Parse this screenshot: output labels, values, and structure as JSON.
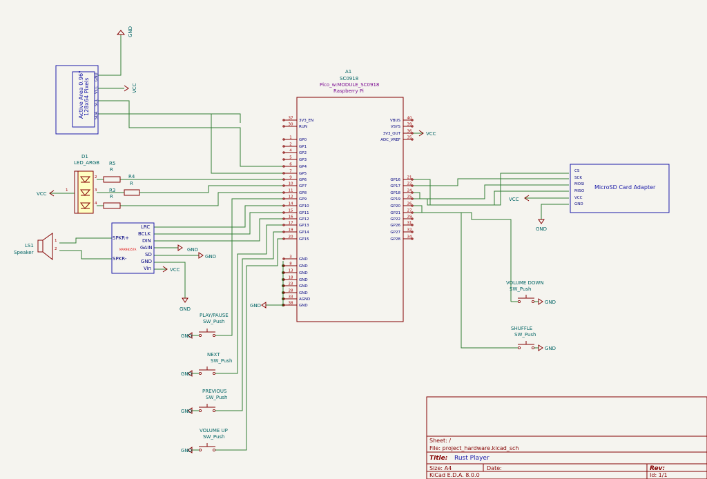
{
  "pico": {
    "ref": "A1",
    "value": "SC0918",
    "footprint": "Pico_w:MODULE_SC0918",
    "vendor": "Raspberry Pi",
    "left_pins": [
      {
        "num": "37",
        "name": "3V3_EN"
      },
      {
        "num": "30",
        "name": "RUN"
      },
      {
        "num": "1",
        "name": "GP0"
      },
      {
        "num": "2",
        "name": "GP1"
      },
      {
        "num": "4",
        "name": "GP2"
      },
      {
        "num": "5",
        "name": "GP3"
      },
      {
        "num": "6",
        "name": "GP4"
      },
      {
        "num": "7",
        "name": "GP5"
      },
      {
        "num": "9",
        "name": "GP6"
      },
      {
        "num": "10",
        "name": "GP7"
      },
      {
        "num": "11",
        "name": "GP8"
      },
      {
        "num": "12",
        "name": "GP9"
      },
      {
        "num": "14",
        "name": "GP10"
      },
      {
        "num": "15",
        "name": "GP11"
      },
      {
        "num": "16",
        "name": "GP12"
      },
      {
        "num": "17",
        "name": "GP13"
      },
      {
        "num": "19",
        "name": "GP14"
      },
      {
        "num": "20",
        "name": "GP15"
      },
      {
        "num": "3",
        "name": "GND"
      },
      {
        "num": "8",
        "name": "GND"
      },
      {
        "num": "13",
        "name": "GND"
      },
      {
        "num": "18",
        "name": "GND"
      },
      {
        "num": "23",
        "name": "GND"
      },
      {
        "num": "28",
        "name": "GND"
      },
      {
        "num": "33",
        "name": "AGND"
      },
      {
        "num": "38",
        "name": "GND"
      }
    ],
    "right_pins": [
      {
        "num": "40",
        "name": "VBUS"
      },
      {
        "num": "39",
        "name": "VSYS"
      },
      {
        "num": "36",
        "name": "3V3_OUT"
      },
      {
        "num": "35",
        "name": "ADC_VREF"
      },
      {
        "num": "21",
        "name": "GP16"
      },
      {
        "num": "22",
        "name": "GP17"
      },
      {
        "num": "24",
        "name": "GP18"
      },
      {
        "num": "25",
        "name": "GP19"
      },
      {
        "num": "26",
        "name": "GP20"
      },
      {
        "num": "27",
        "name": "GP21"
      },
      {
        "num": "29",
        "name": "GP22"
      },
      {
        "num": "31",
        "name": "GP26"
      },
      {
        "num": "32",
        "name": "GP27"
      },
      {
        "num": "34",
        "name": "GP28"
      }
    ]
  },
  "oled": {
    "line1": "Active Area 0.96\"",
    "line2": "128x64 Pixels",
    "pins": [
      "GND",
      "VCC",
      "SCL",
      "SDA"
    ]
  },
  "microsd": {
    "title": "MicroSD Card Adapter",
    "pins": [
      "CS",
      "SCK",
      "MOSI",
      "MISO",
      "VCC",
      "GND"
    ]
  },
  "amp": {
    "pins_left": [
      "SPKR+",
      "SPKR-"
    ],
    "pins_right": [
      "LRC",
      "BCLK",
      "DIN",
      "GAIN",
      "SD",
      "GND",
      "Vin"
    ],
    "part": "MAX98357A"
  },
  "speaker": {
    "ref": "LS1",
    "value": "Speaker",
    "pin1": "1",
    "pin2": "2"
  },
  "led": {
    "ref": "D1",
    "value": "LED_ARGB",
    "pins": [
      "2",
      "3",
      "1",
      "4"
    ]
  },
  "resistors": [
    {
      "ref": "R5",
      "value": "R"
    },
    {
      "ref": "R4",
      "value": "R"
    },
    {
      "ref": "R3",
      "value": "R"
    }
  ],
  "buttons": [
    {
      "name": "PLAY/PAUSE",
      "value": "SW_Push"
    },
    {
      "name": "NEXT",
      "value": "SW_Push"
    },
    {
      "name": "PREVIOUS",
      "value": "SW_Push"
    },
    {
      "name": "VOLUME UP",
      "value": "SW_Push"
    },
    {
      "name": "VOLUME DOWN",
      "value": "SW_Push"
    },
    {
      "name": "SHUFFLE",
      "value": "SW_Push"
    }
  ],
  "power": {
    "gnd": "GND",
    "vcc": "VCC"
  },
  "title_block": {
    "sheet_label": "Sheet: /",
    "file_label": "File: project_hardware.kicad_sch",
    "title_label": "Title:",
    "title_value": "Rust Player",
    "size_label": "Size: A4",
    "date_label": "Date:",
    "rev_label": "Rev:",
    "tool": "KiCad E.D.A. 8.0.0",
    "id_label": "Id: 1/1"
  }
}
